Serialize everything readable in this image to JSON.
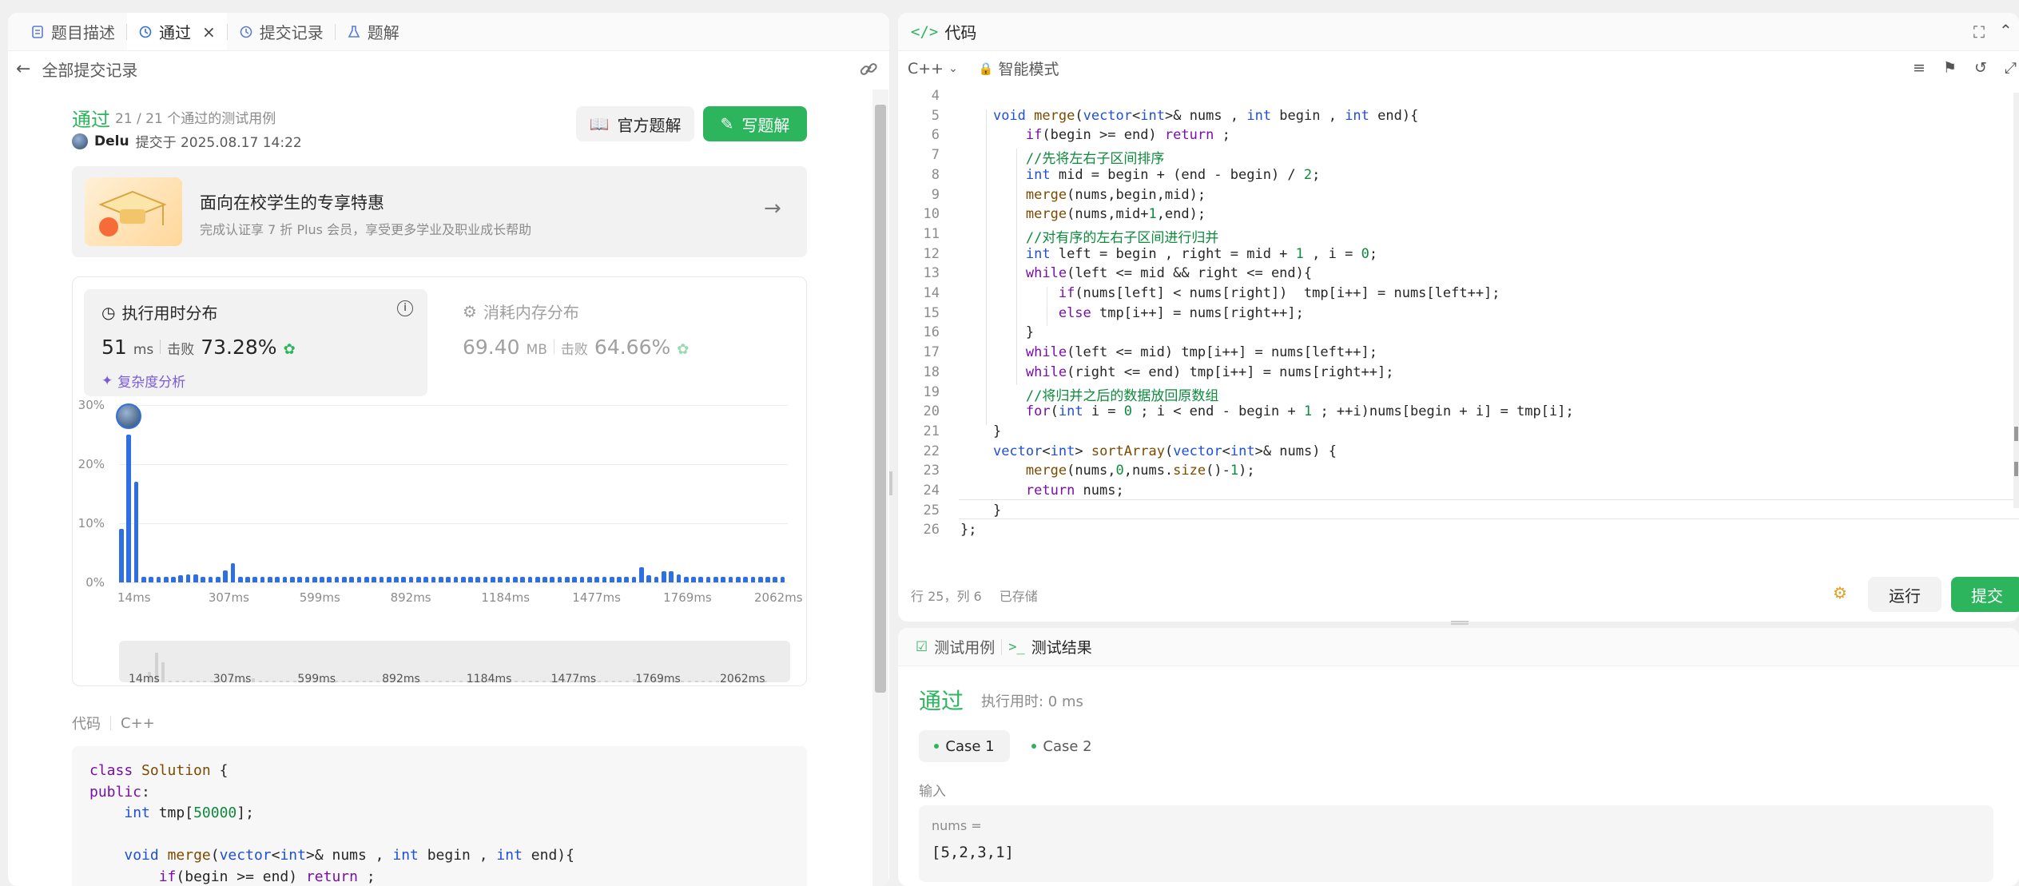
{
  "left_tabs": [
    {
      "label": "题目描述"
    },
    {
      "label": "通过"
    },
    {
      "label": "提交记录"
    },
    {
      "label": "题解"
    }
  ],
  "back_link": "全部提交记录",
  "result": {
    "status": "通过",
    "testcases": "21 / 21 个通过的测试用例",
    "user": "Delu",
    "submitted": "提交于 2025.08.17 14:22",
    "official_solution": "官方题解",
    "write_solution": "写题解"
  },
  "promo": {
    "title": "面向在校学生的专享特惠",
    "subtitle": "完成认证享 7 折 Plus 会员，享受更多学业及职业成长帮助"
  },
  "runtime": {
    "title": "执行用时分布",
    "value": "51",
    "unit": "ms",
    "beats_label": "击败",
    "beats": "73.28%",
    "analysis": "复杂度分析"
  },
  "memory": {
    "title": "消耗内存分布",
    "value": "69.40",
    "unit": "MB",
    "beats_label": "击败",
    "beats": "64.66%"
  },
  "chart_data": {
    "type": "bar",
    "title": "执行用时分布",
    "ylim": [
      0,
      30
    ],
    "yticks": [
      "30%",
      "20%",
      "10%",
      "0%"
    ],
    "xticks": [
      "14ms",
      "307ms",
      "599ms",
      "892ms",
      "1184ms",
      "1477ms",
      "1769ms",
      "2062ms"
    ],
    "values": [
      9,
      25,
      17,
      1,
      1,
      1,
      1,
      1,
      1.2,
      1.4,
      1.3,
      1,
      1,
      1,
      2,
      3.2,
      1,
      1,
      1,
      1,
      1,
      1,
      1,
      1,
      1,
      1,
      1,
      1,
      1,
      1,
      1,
      1,
      1,
      1,
      1,
      1,
      1,
      1,
      1,
      1,
      1,
      1,
      1,
      1,
      1,
      1,
      1,
      1,
      1,
      1,
      1,
      1,
      1,
      1,
      1,
      1,
      1,
      1,
      1,
      1,
      1,
      1,
      1,
      1,
      1,
      1,
      1,
      1,
      1,
      1,
      2.6,
      1.2,
      1,
      1.9,
      1.9,
      1.3,
      1,
      1,
      1,
      1,
      1,
      1,
      1,
      1,
      1,
      1,
      1,
      1,
      1,
      1
    ]
  },
  "code_section": {
    "label": "代码",
    "lang": "C++",
    "lines": [
      "class Solution {",
      "public:",
      "    int tmp[50000];",
      "",
      "    void merge(vector<int>& nums , int begin , int end){",
      "        if(begin >= end) return ;",
      "        //先将左右子区间排序"
    ]
  },
  "editor": {
    "title": "代码",
    "lang": "C++",
    "mode": "智能模式",
    "line_numbers": [
      "4",
      "5",
      "6",
      "7",
      "8",
      "9",
      "10",
      "11",
      "12",
      "13",
      "14",
      "15",
      "16",
      "17",
      "18",
      "19",
      "20",
      "21",
      "22",
      "23",
      "24",
      "25",
      "26"
    ],
    "lines": [
      "",
      "    void merge(vector<int>& nums , int begin , int end){",
      "        if(begin >= end) return ;",
      "        //先将左右子区间排序",
      "        int mid = begin + (end - begin) / 2;",
      "        merge(nums,begin,mid);",
      "        merge(nums,mid+1,end);",
      "        //对有序的左右子区间进行归并",
      "        int left = begin , right = mid + 1 , i = 0;",
      "        while(left <= mid && right <= end){",
      "            if(nums[left] < nums[right])  tmp[i++] = nums[left++];",
      "            else tmp[i++] = nums[right++];",
      "        }",
      "        while(left <= mid) tmp[i++] = nums[left++];",
      "        while(right <= end) tmp[i++] = nums[right++];",
      "        //将归并之后的数据放回原数组",
      "        for(int i = 0 ; i < end - begin + 1 ; ++i)nums[begin + i] = tmp[i];",
      "    }",
      "    vector<int> sortArray(vector<int>& nums) {",
      "        merge(nums,0,nums.size()-1);",
      "        return nums;",
      "    }",
      "};"
    ],
    "status": "行 25，列 6",
    "saved": "已存储",
    "run": "运行",
    "submit": "提交"
  },
  "testpanel": {
    "tab_cases": "测试用例",
    "tab_results": "测试结果",
    "status": "通过",
    "runtime": "执行用时: 0 ms",
    "case1": "Case 1",
    "case2": "Case 2",
    "input_label": "输入",
    "var_label": "nums =",
    "var_value": "[5,2,3,1]"
  }
}
